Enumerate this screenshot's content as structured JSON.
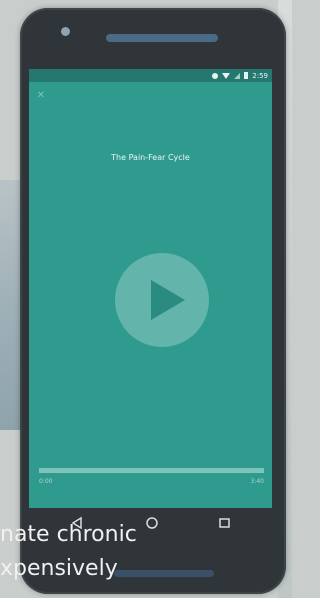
{
  "player": {
    "title": "The Pain-Fear Cycle",
    "elapsed": "0:00",
    "total": "3:40",
    "progress_percent": 0
  },
  "status_bar": {
    "time": "2:59"
  },
  "caption": {
    "line1": "nate chronic",
    "line2": "xpensively"
  },
  "colors": {
    "screen_bg": "#2f9b8e",
    "accent": "#63b5ab"
  },
  "icons": {
    "close": "close-icon",
    "play": "play-icon",
    "back": "back-icon",
    "home": "home-icon",
    "recents": "recents-icon"
  }
}
